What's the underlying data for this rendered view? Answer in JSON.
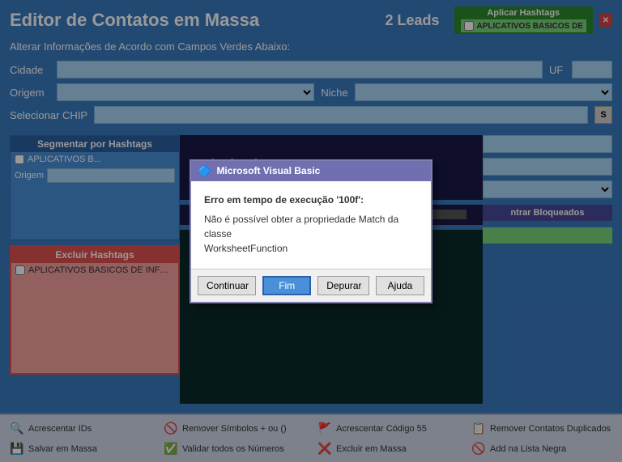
{
  "window": {
    "title": "Editor de Contatos em Massa",
    "leads_label": "2 Leads"
  },
  "subtitle": "Alterar Informações de Acordo com Campos Verdes Abaixo:",
  "form": {
    "cidade_label": "Cidade",
    "uf_label": "UF",
    "origem_label": "Origem",
    "niche_label": "Niche",
    "chip_label": "Selecionar CHIP",
    "chip_btn": "S"
  },
  "segmentar": {
    "header": "Segmentar por Hashtags",
    "origem_label": "Origem",
    "items": [
      {
        "label": "APLICATIVOS B..."
      }
    ]
  },
  "excluir": {
    "header": "Excluir Hashtags",
    "items": [
      {
        "label": "APLICATIVOS BASICOS DE INFORM"
      }
    ]
  },
  "aplicar": {
    "header": "Aplicar Hashtags",
    "items": [
      {
        "label": "APLICATIVOS BASICOS DE"
      }
    ]
  },
  "right_panel": {
    "bloqueados_btn": "ntrar Bloqueados"
  },
  "navigator": {
    "text": "Abrindo nave..."
  },
  "modal": {
    "header": "Microsoft Visual Basic",
    "error_code": "Erro em tempo de execução '100f':",
    "error_msg": "Não é possível obter a propriedade Match da classe\nWorksheetFunction",
    "btn_continue": "Continuar",
    "btn_end": "Fim",
    "btn_debug": "Depurar",
    "btn_help": "Ajuda"
  },
  "toolbar": {
    "buttons": [
      {
        "label": "Acrescentar IDs",
        "icon": "🔍"
      },
      {
        "label": "Remover Símbolos + ou ()",
        "icon": "🚫"
      },
      {
        "label": "Acrescentar Código 55",
        "icon": "🚩"
      },
      {
        "label": "Remover Contatos Duplicados",
        "icon": "📋"
      },
      {
        "label": "Salvar em Massa",
        "icon": "💾"
      },
      {
        "label": "Validar todos os Números",
        "icon": "✅"
      },
      {
        "label": "Excluir em Massa",
        "icon": "❌"
      },
      {
        "label": "Add na Lista Negra",
        "icon": "🚫"
      }
    ]
  }
}
